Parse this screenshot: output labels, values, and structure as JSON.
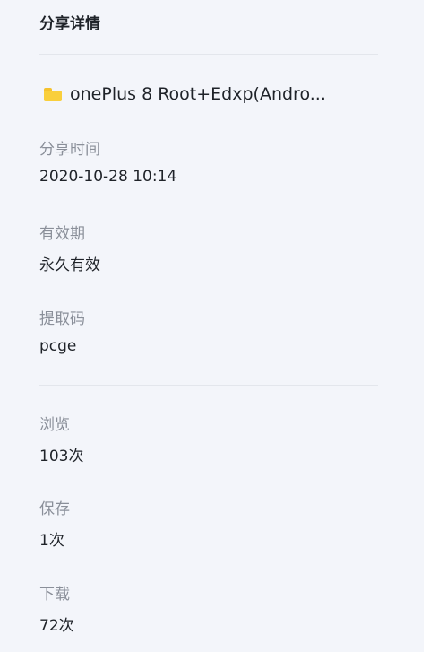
{
  "panel": {
    "title": "分享详情"
  },
  "file": {
    "icon": "folder-icon",
    "icon_color": "#f9cf3c",
    "name": "onePlus 8 Root+Edxp(Andro..."
  },
  "details": [
    {
      "label": "分享时间",
      "value": "2020-10-28 10:14"
    },
    {
      "label": "有效期",
      "value": "永久有效"
    },
    {
      "label": "提取码",
      "value": "pcge"
    }
  ],
  "stats": [
    {
      "label": "浏览",
      "value": "103次"
    },
    {
      "label": "保存",
      "value": "1次"
    },
    {
      "label": "下载",
      "value": "72次"
    }
  ]
}
